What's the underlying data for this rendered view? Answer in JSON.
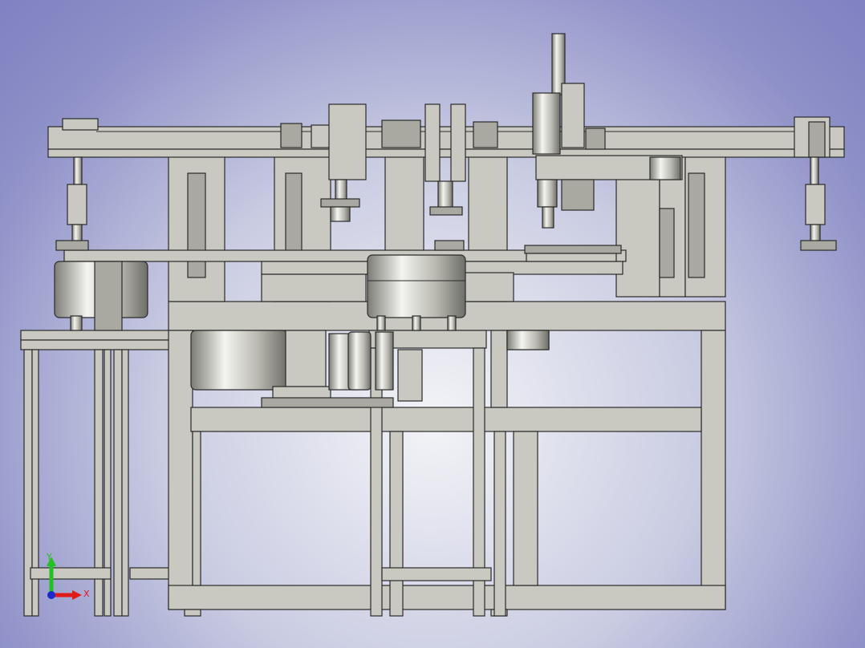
{
  "view": {
    "background_top": "#7f81c2",
    "background_center": "#f3f4f7",
    "frame_color": "#c9c9c2",
    "steel_highlight": "#f4f4f0",
    "steel_shadow": "#7d7d76"
  },
  "triad": {
    "x_label": "X",
    "y_label": "Y",
    "x_color": "#e01a1a",
    "y_color": "#22c022",
    "z_color": "#1a2ad0"
  }
}
